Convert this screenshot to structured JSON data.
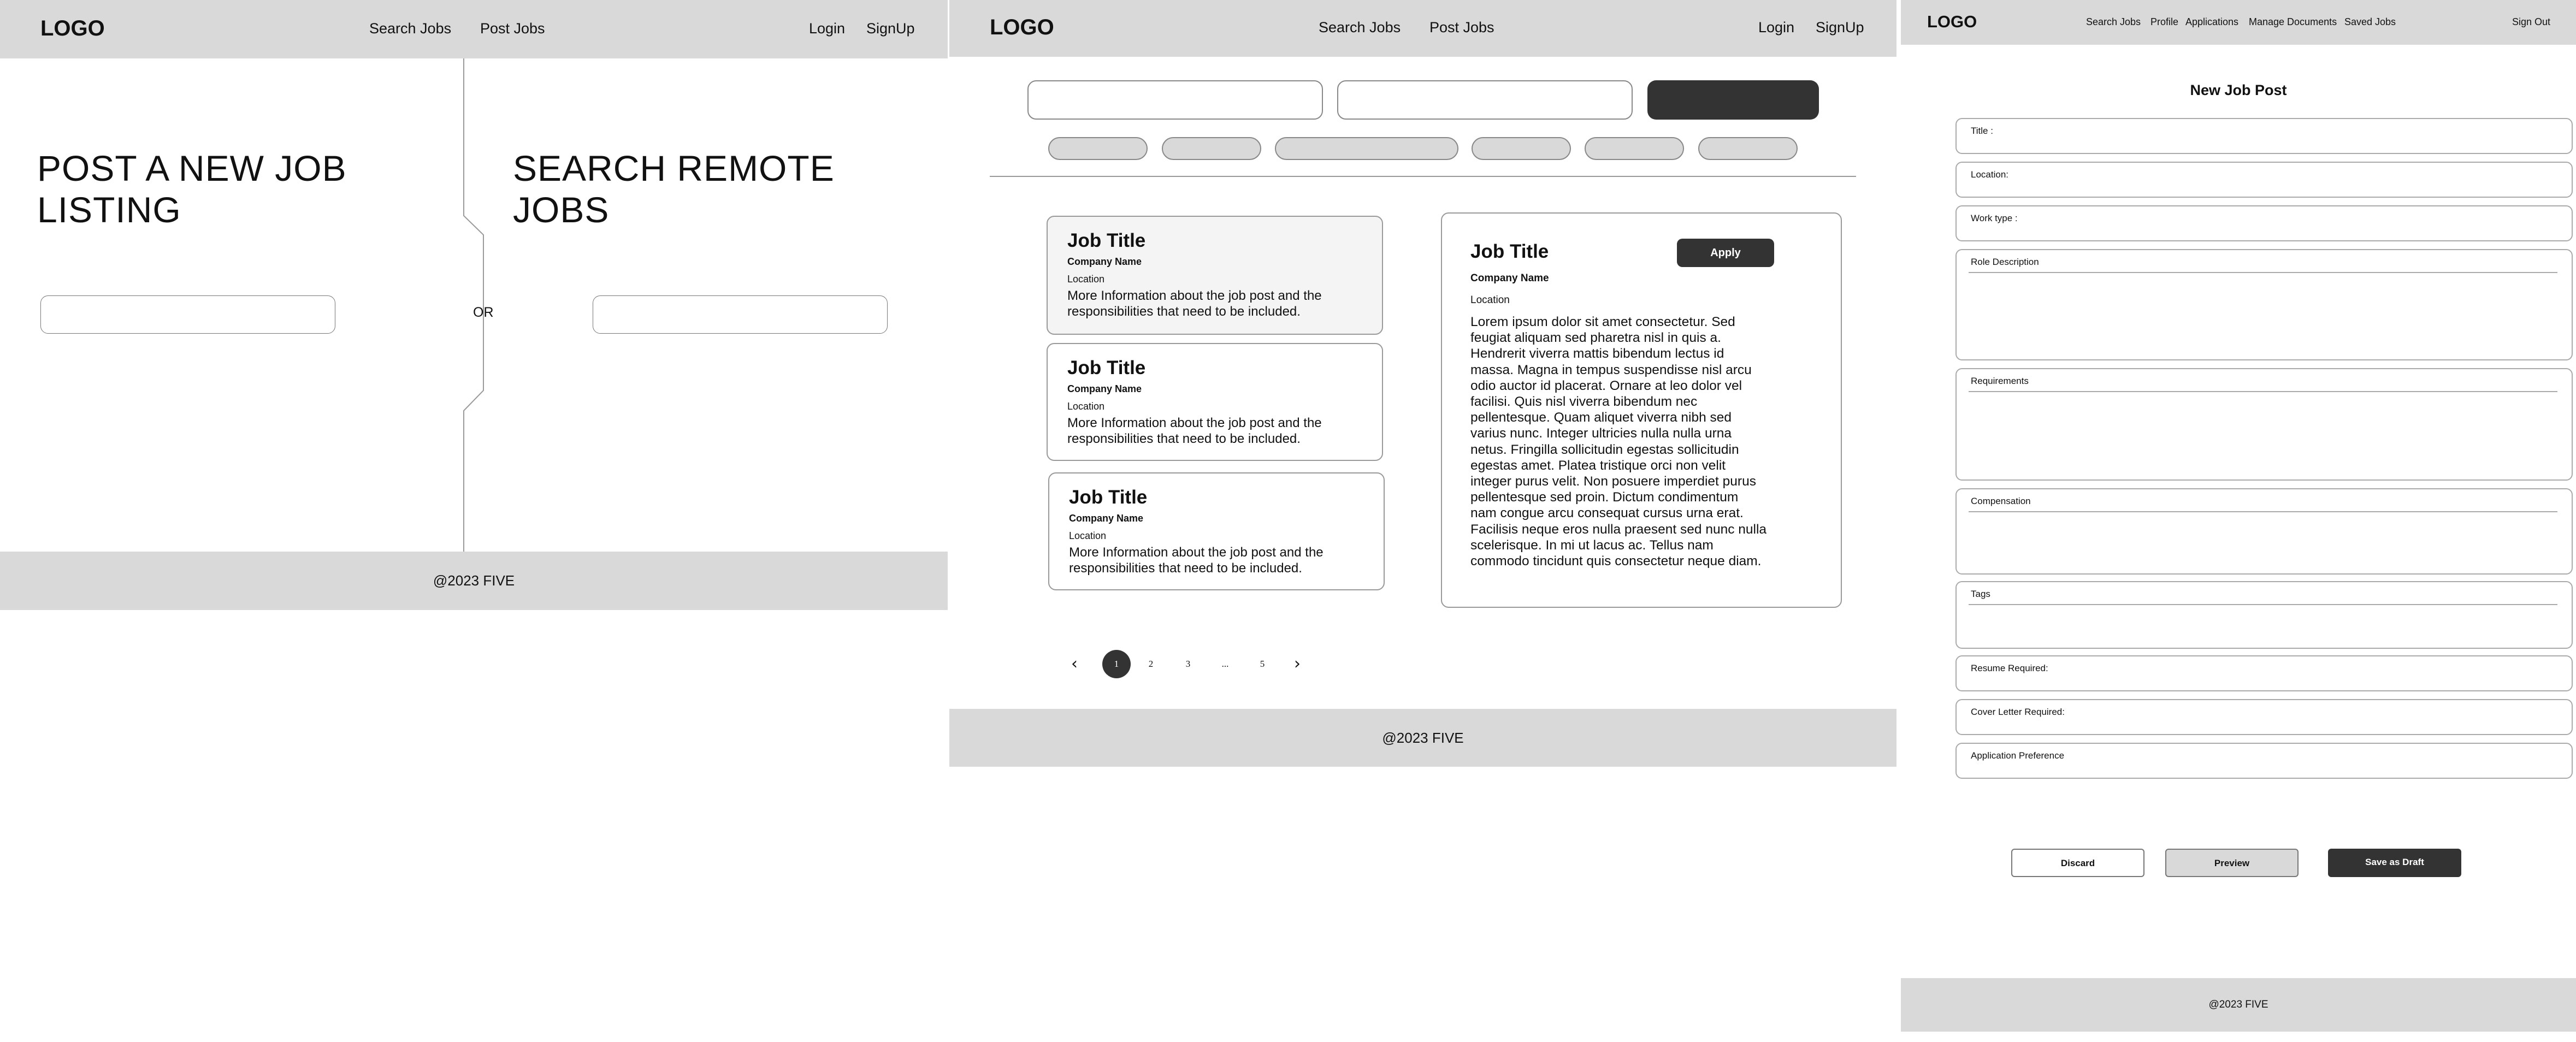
{
  "panel1": {
    "header": {
      "logo": "LOGO",
      "nav": [
        "Search Jobs",
        "Post Jobs"
      ],
      "login": "Login",
      "signup": "SignUp"
    },
    "post_heading": "POST A NEW JOB LISTING",
    "search_heading": "SEARCH REMOTE JOBS",
    "or_label": "OR",
    "footer": "@2023 FIVE"
  },
  "panel2": {
    "header": {
      "logo": "LOGO",
      "nav": [
        "Search Jobs",
        "Post Jobs"
      ],
      "login": "Login",
      "signup": "SignUp"
    },
    "job_cards": [
      {
        "title": "Job Title",
        "company": "Company Name",
        "location": "Location",
        "description": "More Information about the job post and the responsibilities that need to be included."
      },
      {
        "title": "Job Title",
        "company": "Company Name",
        "location": "Location",
        "description": "More Information about the job post and the responsibilities that need to be included."
      },
      {
        "title": "Job Title",
        "company": "Company Name",
        "location": "Location",
        "description": "More Information about the job post and the responsibilities that need to be included."
      }
    ],
    "detail": {
      "title": "Job Title",
      "apply": "Apply",
      "company": "Company Name",
      "location": "Location",
      "body": "Lorem ipsum dolor sit amet consectetur. Sed feugiat aliquam sed pharetra nisl in quis a. Hendrerit viverra mattis bibendum lectus id massa. Magna in tempus suspendisse nisl arcu odio auctor id placerat. Ornare at leo dolor vel facilisi. Quis nisl viverra bibendum nec pellentesque. Quam aliquet viverra nibh sed varius nunc. Integer ultricies nulla nulla urna netus. Fringilla sollicitudin egestas sollicitudin egestas amet. Platea tristique orci non velit integer purus velit. Non posuere imperdiet purus pellentesque sed proin. Dictum condimentum nam congue arcu consequat cursus urna erat. Facilisis neque eros nulla praesent sed nunc nulla scelerisque. In mi ut lacus ac. Tellus nam commodo tincidunt quis consectetur neque diam."
    },
    "pagination": {
      "pages": [
        "1",
        "2",
        "3",
        "...",
        "5"
      ],
      "current": "1",
      "prev_icon": "chevron-left-icon",
      "next_icon": "chevron-right-icon"
    },
    "footer": "@2023 FIVE"
  },
  "panel3": {
    "header": {
      "logo": "LOGO",
      "nav": [
        "Search Jobs",
        "Profile",
        "Applications",
        "Manage Documents",
        "Saved Jobs"
      ],
      "sign_out": "Sign Out"
    },
    "form_title": "New Job Post",
    "fields": [
      "Title :",
      "Location:",
      "Work type :",
      "Role Description",
      "Requirements",
      "Compensation",
      "Tags",
      "Resume Required:",
      "Cover Letter Required:",
      "Application Preference"
    ],
    "buttons": {
      "discard": "Discard",
      "preview": "Preview",
      "save": "Save as Draft"
    },
    "footer": "@2023 FIVE"
  },
  "colors": {
    "header_bg": "#d9d9d9",
    "dark_button": "#333333",
    "border": "#999999"
  }
}
